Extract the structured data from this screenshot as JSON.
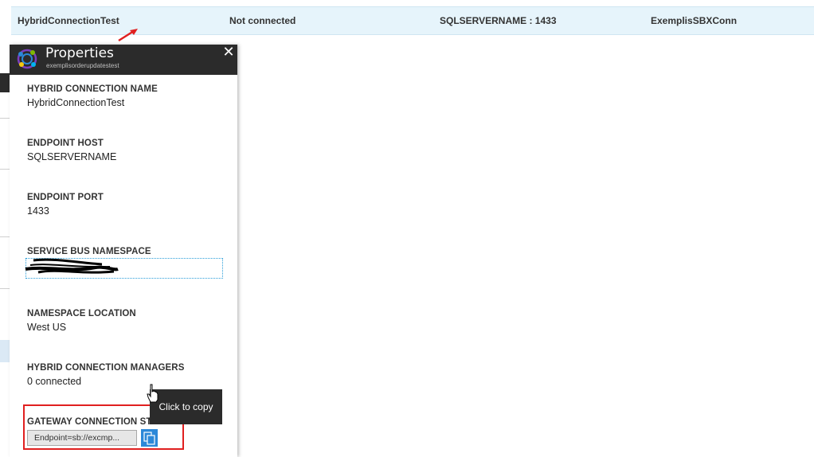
{
  "table_row": {
    "name": "HybridConnectionTest",
    "status": "Not connected",
    "endpoint": "SQLSERVERNAME : 1433",
    "service_bus": "ExemplisSBXConn"
  },
  "blade": {
    "title": "Properties",
    "subtitle": "exemplisorderupdatestest",
    "close_glyph": "✕",
    "properties": [
      {
        "label": "HYBRID CONNECTION NAME",
        "value": "HybridConnectionTest"
      },
      {
        "label": "ENDPOINT HOST",
        "value": "SQLSERVERNAME"
      },
      {
        "label": "ENDPOINT PORT",
        "value": "1433"
      },
      {
        "label": "SERVICE BUS NAMESPACE",
        "value": ""
      },
      {
        "label": "NAMESPACE LOCATION",
        "value": "West US"
      },
      {
        "label": "HYBRID CONNECTION MANAGERS",
        "value": "0 connected"
      },
      {
        "label": "GATEWAY CONNECTION STRING",
        "value": "Endpoint=sb://excmp..."
      }
    ]
  },
  "tooltip": {
    "text": "Click to copy"
  },
  "icons": {
    "logo": "hybrid-connection-logo-icon",
    "close": "close-icon",
    "copy": "copy-icon",
    "cursor": "hand-cursor-icon",
    "arrow": "red-arrow-icon"
  },
  "colors": {
    "row_highlight": "#e6f4fb",
    "header_bg": "#2b2b2b",
    "copy_button": "#2b88d8",
    "annotation_red": "#e02020"
  }
}
